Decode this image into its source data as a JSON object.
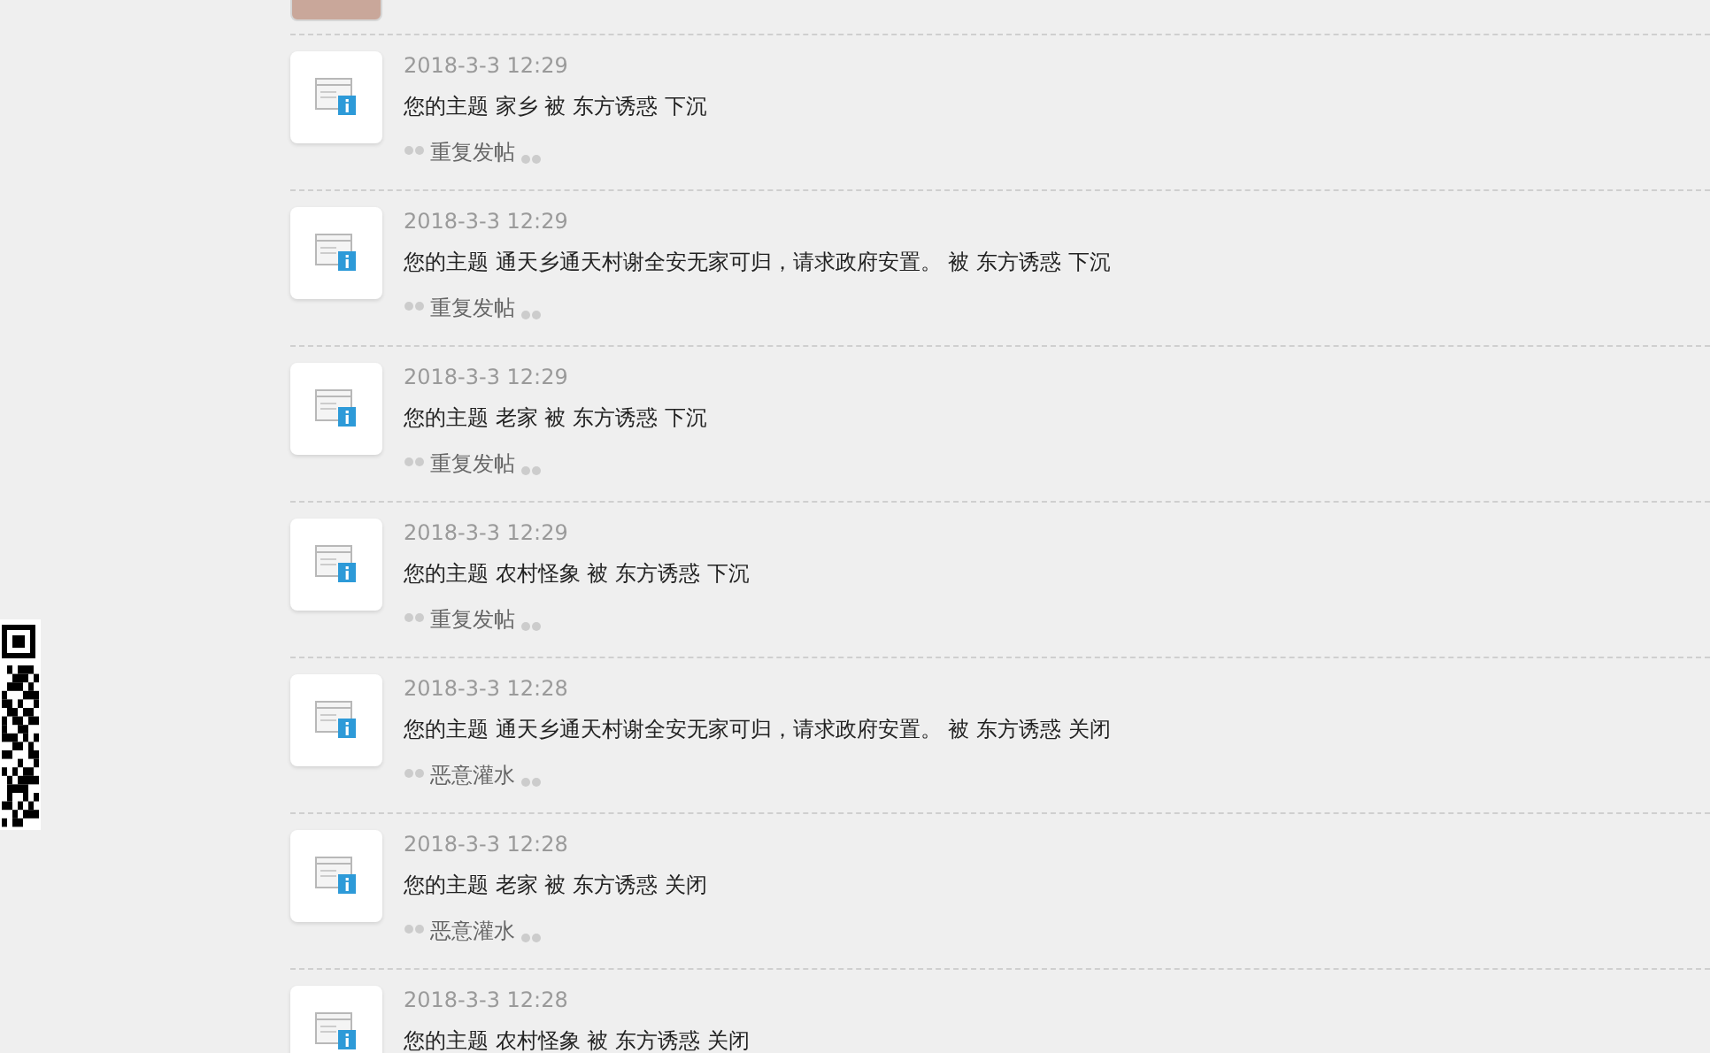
{
  "notices": [
    {
      "time": "2018-3-3 12:29",
      "message": "您的主题 家乡 被 东方诱惑 下沉",
      "reason": "重复发帖"
    },
    {
      "time": "2018-3-3 12:29",
      "message": "您的主题 通天乡通天村谢全安无家可归，请求政府安置。 被 东方诱惑 下沉",
      "reason": "重复发帖"
    },
    {
      "time": "2018-3-3 12:29",
      "message": "您的主题 老家 被 东方诱惑 下沉",
      "reason": "重复发帖"
    },
    {
      "time": "2018-3-3 12:29",
      "message": "您的主题 农村怪象 被 东方诱惑 下沉",
      "reason": "重复发帖"
    },
    {
      "time": "2018-3-3 12:28",
      "message": "您的主题 通天乡通天村谢全安无家可归，请求政府安置。 被 东方诱惑 关闭",
      "reason": "恶意灌水"
    },
    {
      "time": "2018-3-3 12:28",
      "message": "您的主题 老家 被 东方诱惑 关闭",
      "reason": "恶意灌水"
    },
    {
      "time": "2018-3-3 12:28",
      "message": "您的主题 农村怪象 被 东方诱惑 关闭"
    }
  ]
}
